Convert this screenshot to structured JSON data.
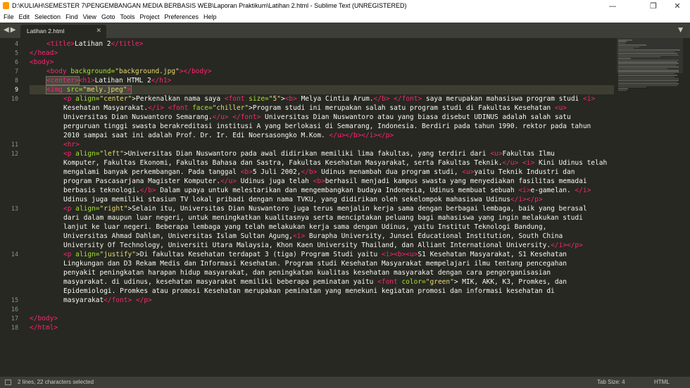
{
  "window": {
    "title": "D:\\KULIAH\\SEMESTER 7\\PENGEMBANGAN MEDIA BERBASIS WEB\\Laporan Praktikum\\Latihan 2.html - Sublime Text (UNREGISTERED)"
  },
  "menu": [
    "File",
    "Edit",
    "Selection",
    "Find",
    "View",
    "Goto",
    "Tools",
    "Project",
    "Preferences",
    "Help"
  ],
  "tab": {
    "label": "Latihan 2.html"
  },
  "gutter": [
    "4",
    "5",
    "6",
    "7",
    "8",
    "9",
    "10",
    "",
    "",
    "",
    "",
    "11",
    "12",
    "",
    "",
    "",
    "",
    "",
    "13",
    "",
    "",
    "",
    "",
    "14",
    "",
    "",
    "",
    "",
    "15",
    "16",
    "17",
    "18"
  ],
  "code": {
    "l4": [
      "<title>",
      "Latihan 2",
      "</title>"
    ],
    "l5": "</head>",
    "l6": "<body>",
    "l7": [
      "<body",
      " background=",
      "\"background.jpg\"",
      ">",
      "</body>"
    ],
    "l8": [
      "<center>",
      "<h1>",
      "Latihan HTML 2",
      "</h1>"
    ],
    "l9": [
      "<img",
      " src=",
      "\"mely.jpeg\"",
      ">"
    ],
    "l10": [
      [
        "<p",
        " align=",
        "\"center\"",
        ">",
        "Perkenalkan nama saya ",
        "<font",
        " size=",
        "\"5\"",
        ">",
        "<b>",
        " Melya Cintia Arum.",
        "</b>",
        " ",
        "</font>",
        " saya merupakan mahasiswa program studi ",
        "<i>"
      ],
      [
        "Kesehatan Masyarakat.",
        "</i>",
        " ",
        "<font",
        " face=",
        "\"chiller\"",
        ">",
        "Program studi ini merupakan salah satu program studi di Fakultas Kesehatan ",
        "<u>"
      ],
      [
        "Universitas Dian Nuswantoro Semarang.",
        "</u>",
        " ",
        "</font>",
        " Universitas Dian Nuswantoro atau yang biasa disebut UDINUS adalah salah satu"
      ],
      [
        "perguruan tinggi swasta berakreditasi institusi A yang berlokasi di Semarang, Indonesia. Berdiri pada tahun 1990. rektor pada tahun"
      ],
      [
        "2010 sampai saat ini adalah Prof. Dr. Ir. Edi Noersasongko M.Kom. ",
        "</u>",
        "</b>",
        "</i>",
        "</p>"
      ]
    ],
    "l11": "<hr>",
    "l12": [
      [
        "<p",
        " align=",
        "\"left\"",
        ">",
        "Universitas Dian Nuswantoro pada awal didirikan memiliki lima fakultas, yang terdiri dari ",
        "<u>",
        "Fakultas Ilmu"
      ],
      [
        "Komputer, Fakultas Ekonomi, Fakultas Bahasa dan Sastra, Fakultas Kesehatan Masyarakat, serta Fakultas Teknik.",
        "</u>",
        " ",
        "<i>",
        " Kini Udinus telah"
      ],
      [
        "mengalami banyak perkembangan. Pada tanggal ",
        "<b>",
        "5 Juli 2002,",
        "</b>",
        " Udinus menambah dua program studi, ",
        "<u>",
        "yaitu Teknik Industri dan"
      ],
      [
        "program Pascasarjana Magister Komputer.",
        "</u>",
        " Udinus juga telah ",
        "<b>",
        "berhasil menjadi kampus swasta yang menyediakan fasilitas memadai"
      ],
      [
        "berbasis teknologi.",
        "</b>",
        " Dalam upaya untuk melestarikan dan mengembangkan budaya Indonesia, Udinus membuat sebuah ",
        "<i>",
        "e-gamelan. ",
        "</i>"
      ],
      [
        "Udinus juga memiliki stasiun TV lokal pribadi dengan nama TVKU, yang didirikan oleh sekelompok mahasiswa Udinus",
        "</i>",
        "</p>"
      ]
    ],
    "l13": [
      [
        "<p",
        " align=",
        "\"right\"",
        ">",
        "Selain itu, Universitas Dian Nuswantoro juga terus menjalin kerja sama dengan berbagai lembaga, baik yang berasal"
      ],
      [
        "dari dalam maupun luar negeri, untuk meningkatkan kualitasnya serta menciptakan peluang bagi mahasiswa yang ingin melakukan studi"
      ],
      [
        "lanjut ke luar negeri. Beberapa lembaga yang telah melakukan kerja sama dengan Udinus, yaitu Institut Teknologi Bandung,"
      ],
      [
        "Universitas Ahmad Dahlan, Universitas Islam Sultan Agung,",
        "<i>",
        " Burapha University, Junsei Educational Institution, South China"
      ],
      [
        "University Of Technology, Universiti Utara Malaysia, Khon Kaen University Thailand, dan Alliant International University.",
        "</i>",
        "</p>"
      ]
    ],
    "l14": [
      [
        "<p",
        " align=",
        "\"justify\"",
        ">",
        "Di fakultas Kesehatan terdapat 3 (tiga) Program Studi yaitu ",
        "<i>",
        "<b>",
        "<u>",
        "S1 Kesehatan Masyarakat, S1 Kesehatan"
      ],
      [
        "Lingkungan dan D3 Rekam Medis dan Informasi Kesehatan. Program studi Kesehatan Masyarakat mempelajari ilmu tentang pencegahan"
      ],
      [
        "penyakit peningkatan harapan hidup masyarakat, dan peningkatan kualitas kesehatan masyarakat dengan cara pengorganisasian"
      ],
      [
        "masyarakat. di udinus, kesehatan masyarakat memiliki beberapa peminatan yaitu ",
        "<font",
        " color=",
        "\"green\"",
        ">",
        " MIK, AKK, K3, Promkes, dan"
      ],
      [
        "Epidemiologi. Promkes atau promosi Kesehatan merupakan peminatan yang menekuni kegiatan promosi dan informasi kesehatan di"
      ],
      [
        "masyarakat",
        "</font>",
        " ",
        "</p>"
      ]
    ],
    "l16": "</body>",
    "l17": "</html>"
  },
  "status": {
    "selection": "2 lines, 22 characters selected",
    "tab_size": "Tab Size: 4",
    "syntax": "HTML"
  },
  "colors": {
    "background": "#272822",
    "tag": "#f92672",
    "attribute": "#a6e22e",
    "string": "#e6db74",
    "text": "#f8f8f2"
  }
}
